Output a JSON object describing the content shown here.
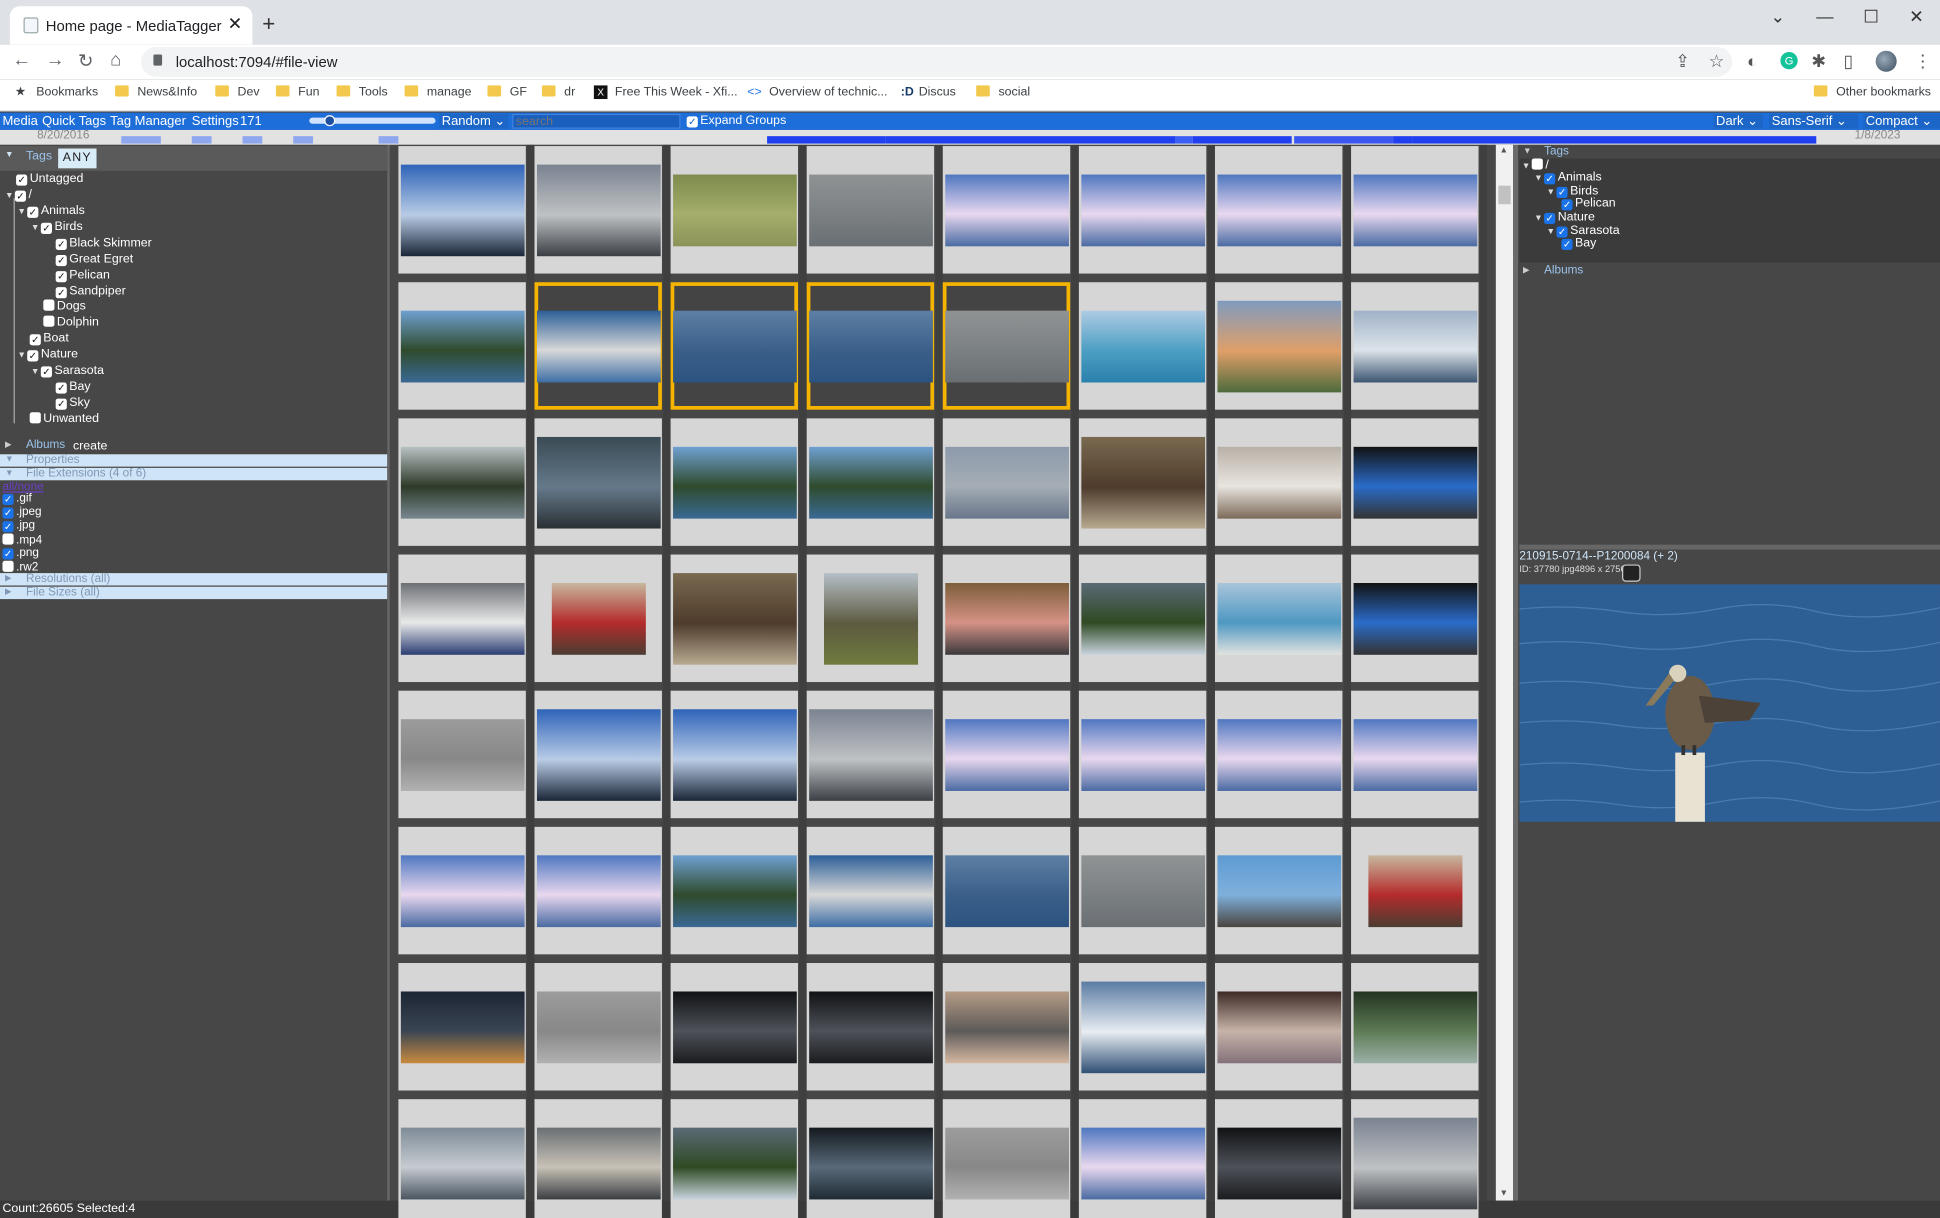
{
  "browser": {
    "tab_title": "Home page - MediaTagger",
    "url": "localhost:7094/#file-view",
    "bookmarks": [
      "Bookmarks",
      "News&Info",
      "Dev",
      "Fun",
      "Tools",
      "manage",
      "GF",
      "dr",
      "Free This Week - Xfi...",
      "Overview of technic...",
      "Discus",
      "social"
    ],
    "other_bookmarks": "Other bookmarks"
  },
  "menubar": {
    "items": [
      "Media",
      "Quick Tags",
      "Tag Manager",
      "Settings"
    ],
    "count": "171",
    "sort": "Random",
    "search_placeholder": "search",
    "expand_groups": "Expand Groups",
    "theme": "Dark",
    "font": "Sans-Serif",
    "layout": "Compact"
  },
  "timeline": {
    "start": "8/20/2016",
    "end": "1/8/2023"
  },
  "left": {
    "tags_header": "Tags",
    "match_mode": "ANY",
    "tags": [
      {
        "label": "Untagged",
        "check": "✓"
      },
      {
        "label": "/",
        "check": "✓"
      },
      {
        "label": "Animals",
        "check": "✓"
      },
      {
        "label": "Birds",
        "check": "✓"
      },
      {
        "label": "Black Skimmer",
        "check": "✓"
      },
      {
        "label": "Great Egret",
        "check": "✓"
      },
      {
        "label": "Pelican",
        "check": "✓"
      },
      {
        "label": "Sandpiper",
        "check": "✓"
      },
      {
        "label": "Dogs",
        "check": ""
      },
      {
        "label": "Dolphin",
        "check": ""
      },
      {
        "label": "Boat",
        "check": "✓"
      },
      {
        "label": "Nature",
        "check": "✓"
      },
      {
        "label": "Sarasota",
        "check": "✓"
      },
      {
        "label": "Bay",
        "check": "✓"
      },
      {
        "label": "Sky",
        "check": "✓"
      },
      {
        "label": "Unwanted",
        "check": ""
      }
    ],
    "albums_header": "Albums",
    "albums_create": "create",
    "properties_header": "Properties",
    "extensions_header": "File Extensions (4 of 6)",
    "extensions_toggle": "all/none",
    "extensions": [
      {
        "label": ".gif",
        "checked": true
      },
      {
        "label": ".jpeg",
        "checked": true
      },
      {
        "label": ".jpg",
        "checked": true
      },
      {
        "label": ".mp4",
        "checked": false
      },
      {
        "label": ".png",
        "checked": true
      },
      {
        "label": ".rw2",
        "checked": false
      }
    ],
    "resolutions_header": "Resolutions (all)",
    "filesizes_header": "File Sizes (all)"
  },
  "right": {
    "tags_header": "Tags",
    "tags": [
      {
        "label": "/",
        "check": ""
      },
      {
        "label": "Animals",
        "check": "✓"
      },
      {
        "label": "Birds",
        "check": "✓"
      },
      {
        "label": "Pelican",
        "check": "✓"
      },
      {
        "label": "Nature",
        "check": "✓"
      },
      {
        "label": "Sarasota",
        "check": "✓"
      },
      {
        "label": "Bay",
        "check": "✓"
      }
    ],
    "albums_header": "Albums",
    "file_name": "210915-0714--P1200084 (+ 2)",
    "file_info": "ID: 37780 jpg4896 x 2756"
  },
  "status": "Count:26605 Selected:4",
  "thumbs": [
    [
      "sky",
      "dusk",
      "grass",
      "water",
      "cloud",
      "cloud",
      "cloud",
      "cloud"
    ],
    [
      "mangrove",
      "pelicanSel",
      "bluewSel",
      "bluewSel",
      "bayoSel",
      "boats",
      "palm",
      "marina"
    ],
    [
      "trees",
      "bench",
      "mangrove",
      "mangrove",
      "haze",
      "room",
      "bed",
      "tv"
    ],
    [
      "plate",
      "people",
      "room",
      "mountain",
      "group",
      "foliage",
      "beach",
      "tv"
    ],
    [
      "sand",
      "sky",
      "sky",
      "dusk",
      "cloud",
      "cloud",
      "cloud",
      "cloud"
    ],
    [
      "cloud",
      "cloud",
      "mangrove",
      "pelican",
      "bluew",
      "water",
      "birds",
      "people"
    ],
    [
      "night",
      "sand",
      "dark",
      "dark",
      "heron",
      "sail",
      "fence",
      "forest"
    ],
    [
      "wave",
      "seal",
      "foliage",
      "dash",
      "sand",
      "cloud",
      "dark",
      "dusk"
    ]
  ]
}
